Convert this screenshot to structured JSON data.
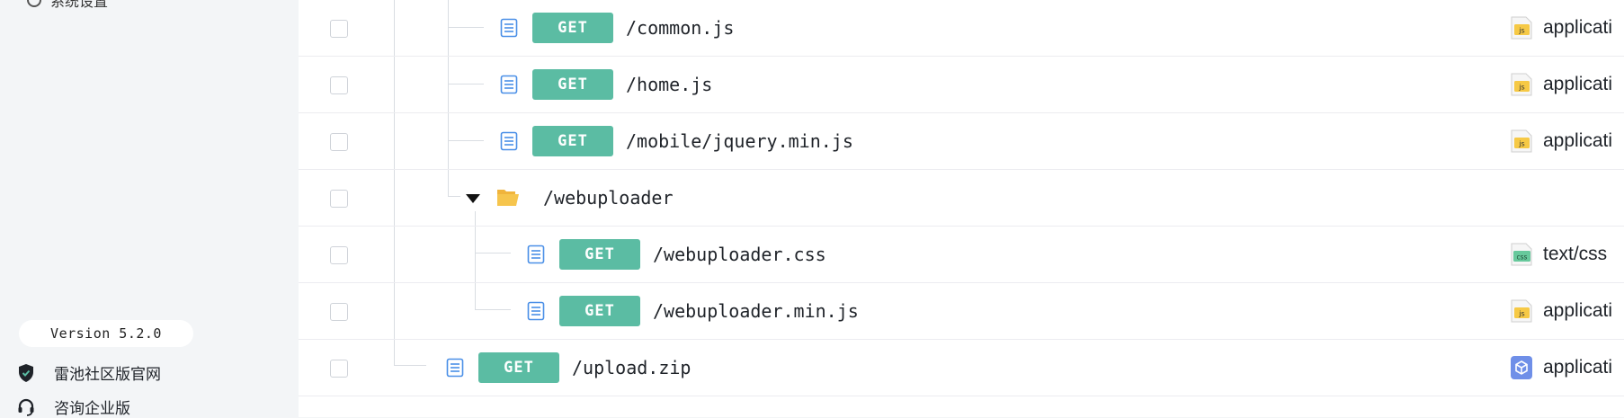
{
  "sidebar": {
    "top_item_label": "系统设置",
    "version": "Version 5.2.0",
    "links": [
      {
        "label": "雷池社区版官网",
        "icon": "shield-icon"
      },
      {
        "label": "咨询企业版",
        "icon": "headset-icon"
      }
    ]
  },
  "colors": {
    "method_bg": "#5bbca3",
    "doc_icon": "#4a8fe7",
    "folder": "#f0b43c",
    "js_badge": "#f6c945",
    "css_badge": "#67c99c",
    "zip_badge": "#6f8fe8"
  },
  "rows": [
    {
      "method": "GET",
      "path": "/common.js",
      "content_type": "applicati",
      "type_icon": "js-file-icon",
      "type_badge": "js"
    },
    {
      "method": "GET",
      "path": "/home.js",
      "content_type": "applicati",
      "type_icon": "js-file-icon",
      "type_badge": "js"
    },
    {
      "method": "GET",
      "path": "/mobile/jquery.min.js",
      "content_type": "applicati",
      "type_icon": "js-file-icon",
      "type_badge": "js"
    },
    {
      "folder": "/webuploader",
      "icon": "folder-open-icon"
    },
    {
      "method": "GET",
      "path": "/webuploader.css",
      "content_type": "text/css",
      "type_icon": "css-file-icon",
      "type_badge": "css"
    },
    {
      "method": "GET",
      "path": "/webuploader.min.js",
      "content_type": "applicati",
      "type_icon": "js-file-icon",
      "type_badge": "js"
    },
    {
      "method": "GET",
      "path": "/upload.zip",
      "content_type": "applicati",
      "type_icon": "package-icon"
    }
  ]
}
